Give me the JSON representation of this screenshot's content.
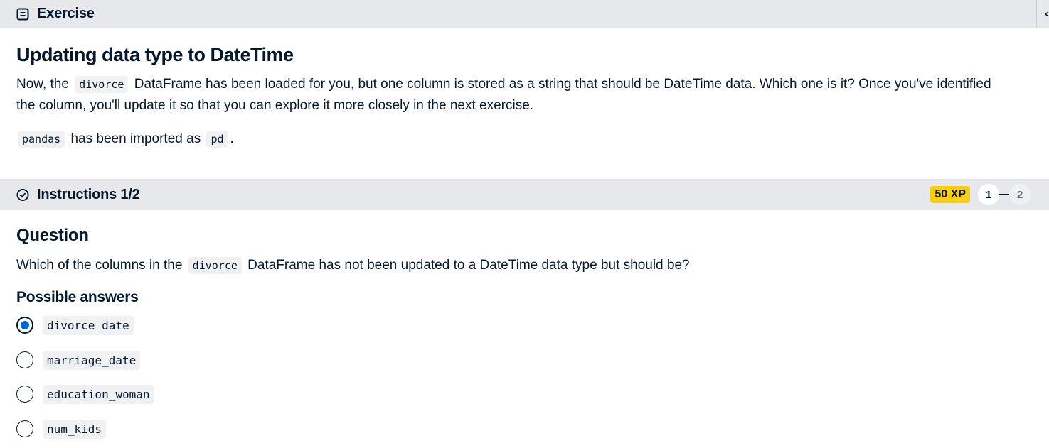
{
  "exercise_header": {
    "title": "Exercise",
    "icon": "exercise-icon"
  },
  "exercise": {
    "title": "Updating data type to DateTime",
    "paragraph1": {
      "before": "Now, the",
      "code": "divorce",
      "after": "DataFrame has been loaded for you, but one column is stored as a string that should be DateTime data. Which one is it? Once you've identified the column, you'll update it so that you can explore it more closely in the next exercise."
    },
    "paragraph2": {
      "code1": "pandas",
      "middle": "has been imported as",
      "code2": "pd",
      "end": "."
    }
  },
  "instructions_header": {
    "title": "Instructions 1/2",
    "icon": "check-circle-icon",
    "xp_badge": "50 XP",
    "steps": [
      "1",
      "2"
    ],
    "active_step": "1"
  },
  "question": {
    "title": "Question",
    "text_before": "Which of the columns in the",
    "code": "divorce",
    "text_after": "DataFrame has not been updated to a DateTime data type but should be?"
  },
  "answers": {
    "title": "Possible answers",
    "options": [
      {
        "label": "divorce_date",
        "selected": true
      },
      {
        "label": "marriage_date",
        "selected": false
      },
      {
        "label": "education_woman",
        "selected": false
      },
      {
        "label": "num_kids",
        "selected": false
      }
    ]
  },
  "colors": {
    "header_bg": "#e6e8ec",
    "text": "#05192d",
    "xp_badge": "#fcce0d",
    "radio_selected": "#0065d1"
  }
}
